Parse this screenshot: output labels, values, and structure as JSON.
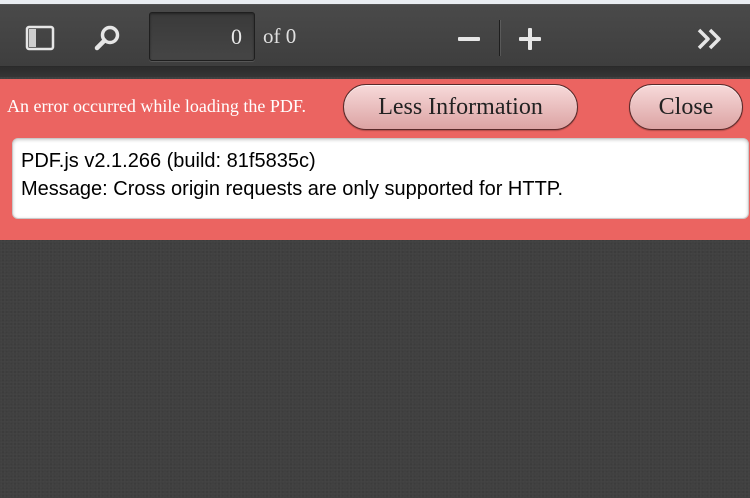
{
  "toolbar": {
    "sidebar_toggle_icon": "sidebar-icon",
    "search_icon": "search-icon",
    "page_number": "0",
    "num_pages": "of 0",
    "zoom_out_icon": "minus-icon",
    "zoom_in_icon": "plus-icon",
    "tools_icon": "double-chevron-right-icon"
  },
  "error": {
    "message": "An error occurred while loading the PDF.",
    "less_info_label": "Less Information",
    "close_label": "Close",
    "details": [
      "PDF.js v2.1.266 (build: 81f5835c)",
      "Message: Cross origin requests are only supported for HTTP."
    ],
    "background_color": "#eb6461"
  }
}
